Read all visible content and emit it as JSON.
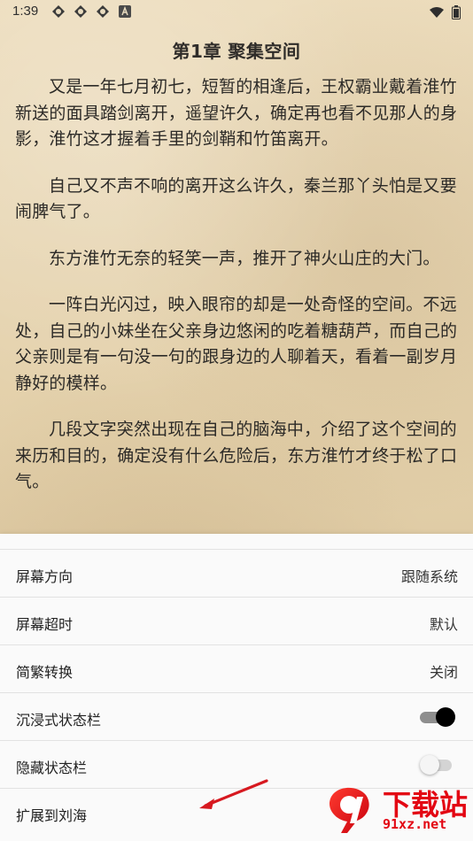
{
  "status": {
    "time": "1:39",
    "left_icons": [
      "app-icon",
      "app-icon",
      "app-icon",
      "a-icon"
    ],
    "right_icons": [
      "wifi-icon",
      "battery-icon"
    ]
  },
  "chapter": {
    "title": "第1章 聚集空间",
    "paragraphs": [
      "又是一年七月初七，短暂的相逢后，王权霸业戴着淮竹新送的面具踏剑离开，遥望许久，确定再也看不见那人的身影，淮竹这才握着手里的剑鞘和竹笛离开。",
      "自己又不声不响的离开这么许久，秦兰那丫头怕是又要闹脾气了。",
      "东方淮竹无奈的轻笑一声，推开了神火山庄的大门。",
      "一阵白光闪过，映入眼帘的却是一处奇怪的空间。不远处，自己的小妹坐在父亲身边悠闲的吃着糖葫芦，而自己的父亲则是有一句没一句的跟身边的人聊着天，看着一副岁月静好的模样。",
      "几段文字突然出现在自己的脑海中，介绍了这个空间的来历和目的，确定没有什么危险后，东方淮竹才终于松了口气。"
    ]
  },
  "settings": {
    "screen_orientation": {
      "label": "屏幕方向",
      "value": "跟随系统"
    },
    "screen_timeout": {
      "label": "屏幕超时",
      "value": "默认"
    },
    "simplified_traditional": {
      "label": "简繁转换",
      "value": "关闭"
    },
    "immersive_status_bar": {
      "label": "沉浸式状态栏",
      "enabled": true
    },
    "hide_status_bar": {
      "label": "隐藏状态栏",
      "enabled": false
    },
    "extend_to_notch": {
      "label": "扩展到刘海"
    }
  },
  "watermark": {
    "title": "下载站",
    "url": "91xz.net"
  },
  "colors": {
    "watermark_red": "#e30613",
    "toggle_on": "#000000",
    "sheet_background": "#fafafa"
  }
}
